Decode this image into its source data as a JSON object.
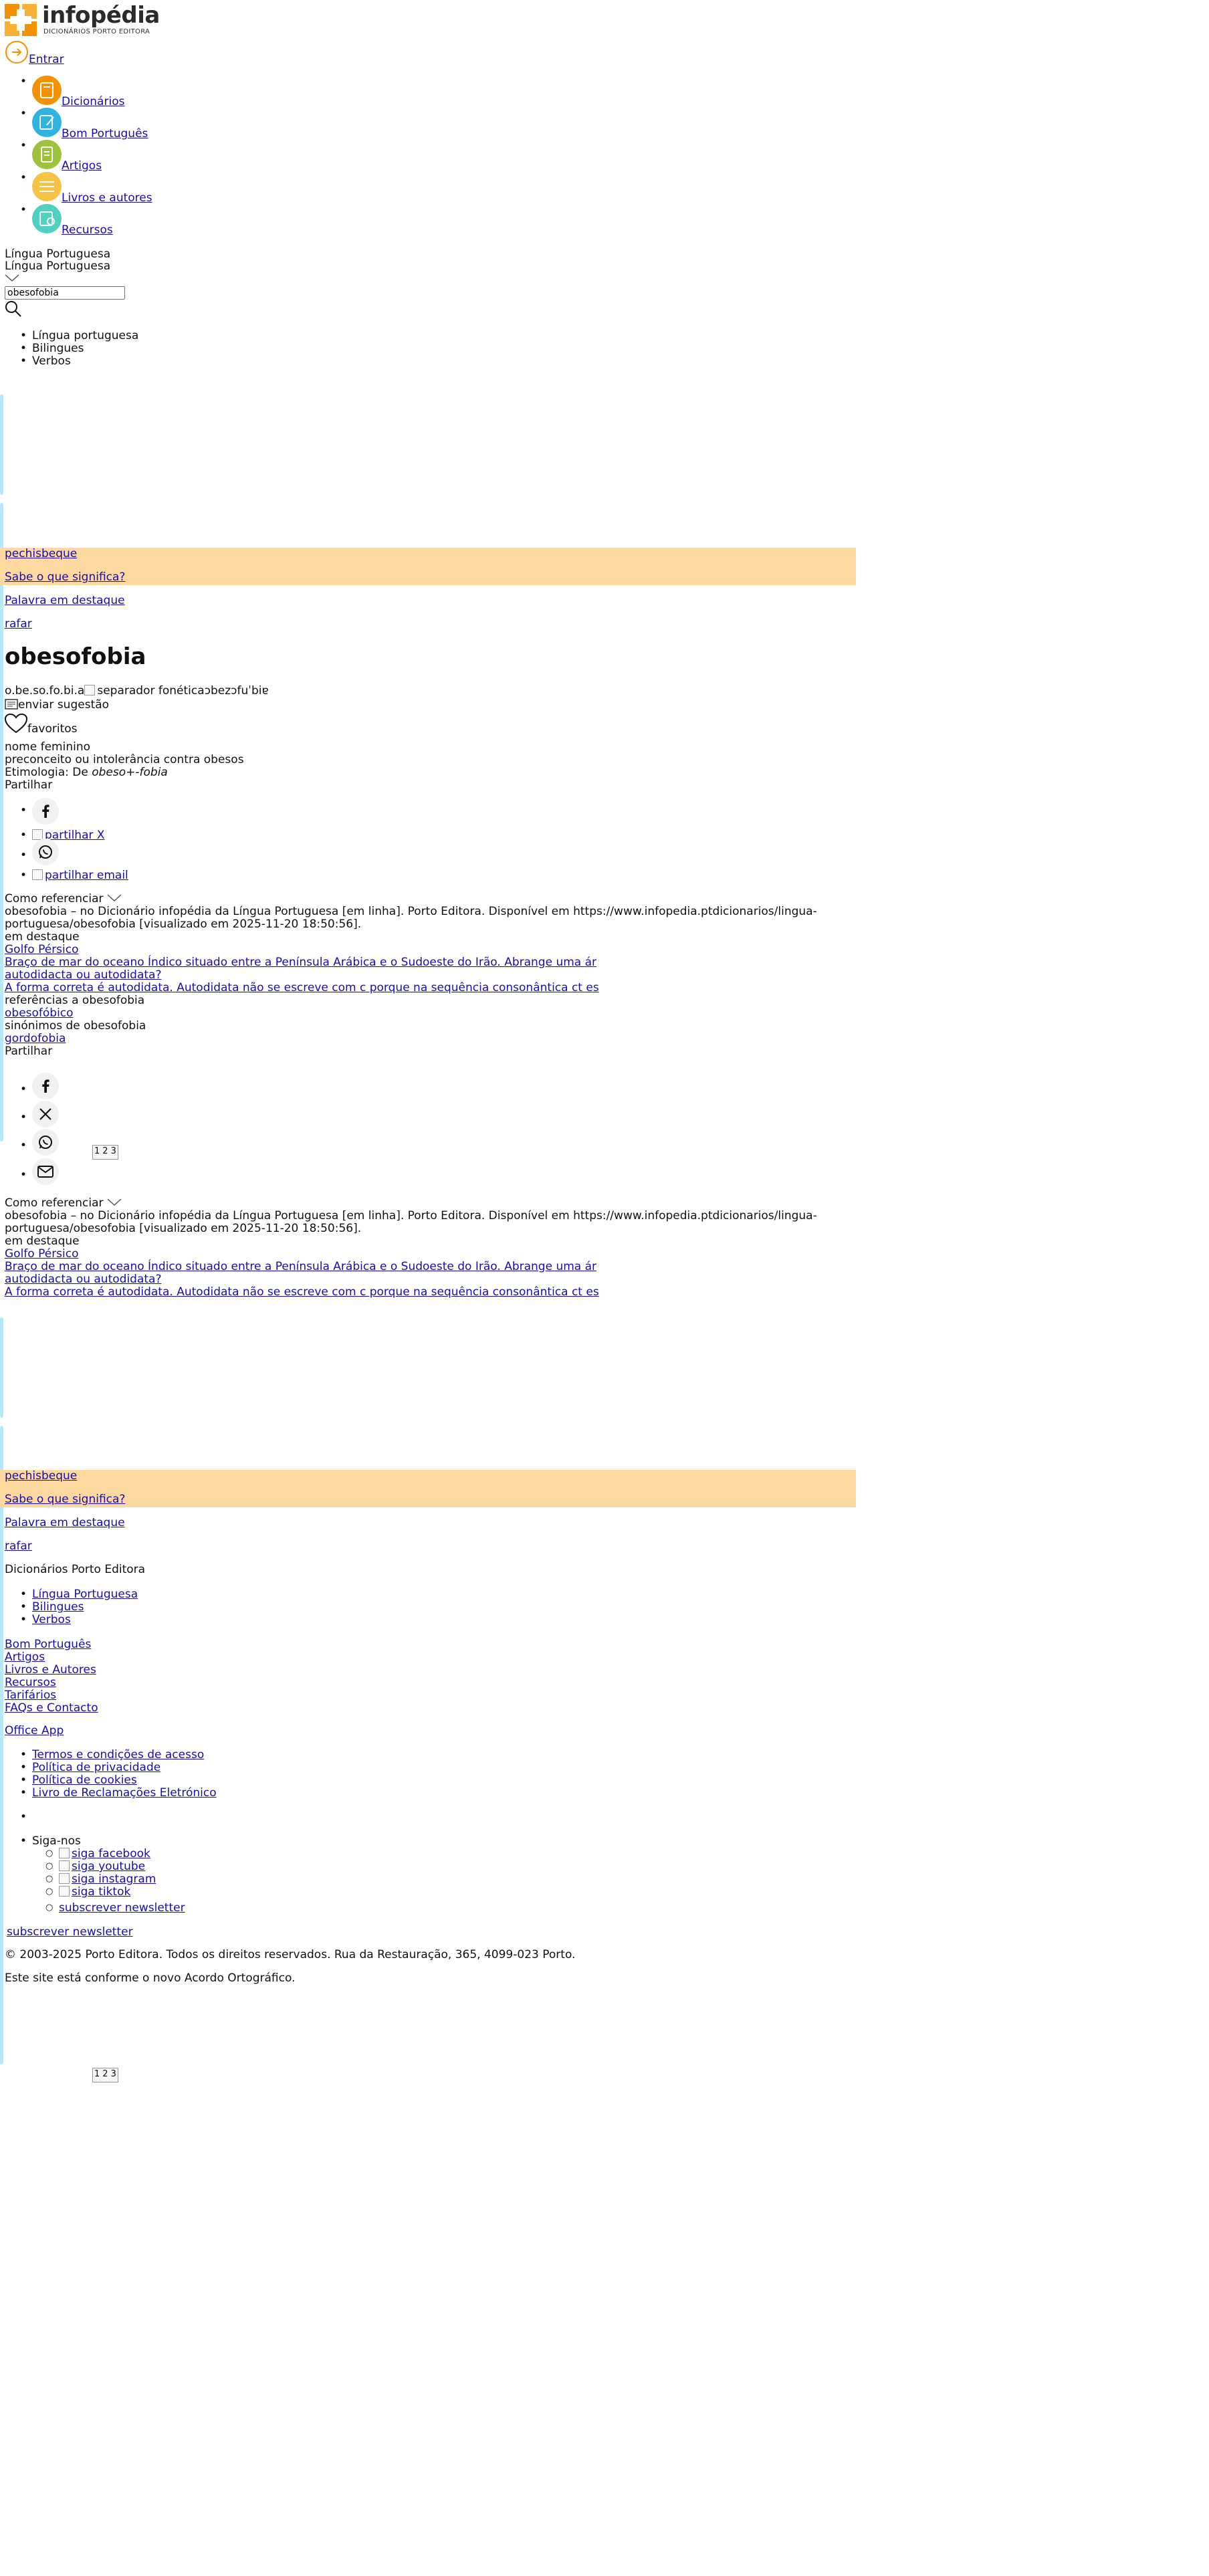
{
  "header": {
    "logo_text": "infopédia",
    "logo_subtitle": "DICIONÁRIOS PORTO EDITORA",
    "login_label": "Entrar",
    "brand_color": "#f39200"
  },
  "nav": [
    {
      "label": "Dicionários",
      "icon": "book-icon",
      "color": "#f39200"
    },
    {
      "label": "Bom Português",
      "icon": "edit-icon",
      "color": "#2fb3e0"
    },
    {
      "label": "Artigos",
      "icon": "document-icon",
      "color": "#9bc43c"
    },
    {
      "label": "Livros e autores",
      "icon": "books-icon",
      "color": "#f7c347"
    },
    {
      "label": "Recursos",
      "icon": "resources-icon",
      "color": "#4fd0c0"
    }
  ],
  "search": {
    "dictionary_label": "Língua Portuguesa",
    "dictionary_selected": "Língua Portuguesa",
    "query": "obesofobia",
    "tabs": [
      "Língua portuguesa",
      "Bilingues",
      "Verbos"
    ]
  },
  "promo": {
    "word": "pechisbeque",
    "question": "Sabe o que significa?",
    "highlight_label": "Palavra em destaque",
    "word2": "rafar"
  },
  "entry": {
    "headword": "obesofobia",
    "syllables": "o.be.so.fo.bi.a",
    "separator_alt": "separador fonética",
    "phonetic": "ɔbezɔfuˈbiɐ",
    "suggest_label": "enviar sugestão",
    "favorites_label": "favoritos",
    "grammar": "nome feminino",
    "definition": "preconceito ou intolerância contra obesos",
    "etymology_prefix": "Etimologia: De ",
    "etymology_term": "obeso+-fobia",
    "share_label": "Partilhar",
    "share_x_alt": "partilhar X",
    "share_email_alt": "partilhar email",
    "cite_label": "Como referenciar",
    "cite_text_1": "obesofobia – no Dicionário infopédia da Língua Portuguesa [em linha]. Porto Editora. Disponível em https://www.infopedia.ptdicionarios/lingua-",
    "cite_text_2": "portuguesa/obesofobia [visualizado em 2025-11-20 18:50:56].",
    "featured_label": "em destaque",
    "featured_title": "Golfo Pérsico",
    "featured_desc_1": "Braço de mar do oceano Índico situado entre a Península Arábica e o Sudoeste do Irão. Abrange uma ár",
    "featured_q": "autodidacta ou autodidata?",
    "featured_a": "A forma correta é autodidata. Autodidata não se escreve com c porque na sequência consonântica ct es",
    "refs_label": "referências a obesofobia",
    "refs_item": "obesofóbico",
    "syn_label": "sinónimos de obesofobia",
    "syn_item": "gordofobia"
  },
  "pager": [
    "1",
    "2",
    "3"
  ],
  "footer": {
    "title": "Dicionários Porto Editora",
    "dict_links": [
      "Língua Portuguesa",
      "Bilingues",
      "Verbos"
    ],
    "links": [
      "Bom Português",
      "Artigos",
      "Livros e Autores",
      "Recursos",
      "Tarifários",
      "FAQs e Contacto"
    ],
    "office_app": "Office App",
    "legal": [
      "Termos e condições de acesso",
      "Política de privacidade",
      "Política de cookies",
      "Livro de Reclamações Eletrónico"
    ],
    "follow_label": "Siga-nos",
    "social": [
      "siga facebook",
      "siga youtube",
      "siga instagram",
      "siga tiktok"
    ],
    "newsletter_sub": "subscrever newsletter",
    "newsletter_label": "subscrever newsletter",
    "copyright": "© 2003-2025 Porto Editora. Todos os direitos reservados. Rua da Restauração, 365, 4099-023 Porto.",
    "ao_note": "Este site está conforme o novo Acordo Ortográfico."
  }
}
